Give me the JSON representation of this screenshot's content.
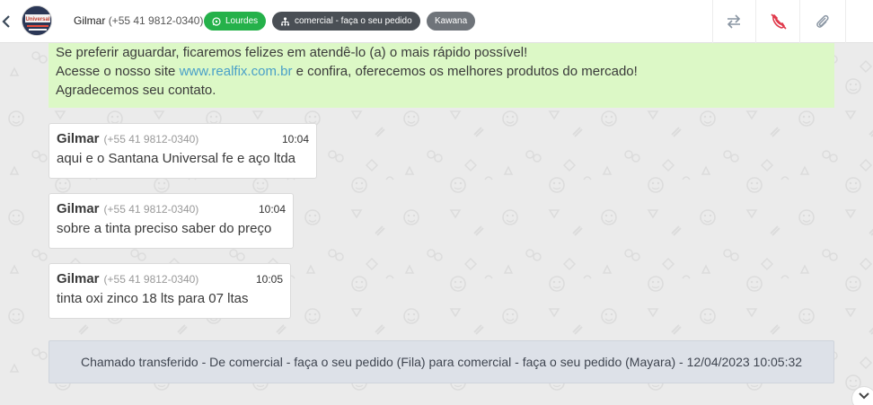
{
  "header": {
    "contact_name": "Gilmar",
    "contact_phone": "(+55 41 9812-0340)",
    "avatar_text": "Universal",
    "channel_pill": "Lourdes",
    "queue_pill": "comercial - faça o seu pedido",
    "agent_pill": "Kawana",
    "icons": [
      "back-icon",
      "transfer-icon",
      "end-call-icon",
      "attach-icon"
    ]
  },
  "banner": {
    "line1": "Se preferir aguardar, ficaremos felizes em atendê-lo (a) o mais rápido possível!",
    "line2_prefix": "Acesse o nosso site ",
    "line2_link": "www.realfix.com.br",
    "line2_suffix": " e confira, oferecemos os melhores produtos do mercado!",
    "line3": "Agradecemos seu contato."
  },
  "messages": [
    {
      "sender": "Gilmar",
      "phone": "(+55 41 9812-0340)",
      "time": "10:04",
      "text": "aqui e o Santana Universal fe e aço ltda"
    },
    {
      "sender": "Gilmar",
      "phone": "(+55 41 9812-0340)",
      "time": "10:04",
      "text": "sobre a tinta preciso saber do preço"
    },
    {
      "sender": "Gilmar",
      "phone": "(+55 41 9812-0340)",
      "time": "10:05",
      "text": "tinta oxi zinco 18 lts para 07 ltas"
    }
  ],
  "system_message": "Chamado transferido - De comercial - faça o seu pedido (Fila) para comercial - faça o seu pedido (Mayara) - 12/04/2023 10:05:32",
  "colors": {
    "banner_bg": "#dcf8c6",
    "whatsapp_green": "#25b14a",
    "end_call_red": "#e0394b",
    "link": "#4aa0c8"
  }
}
